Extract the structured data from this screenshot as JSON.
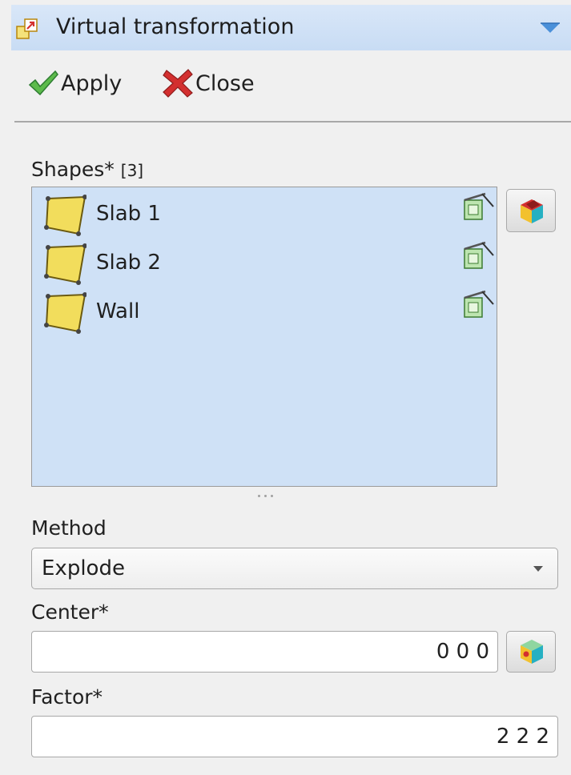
{
  "panel": {
    "title": "Virtual transformation"
  },
  "actions": {
    "apply_label": "Apply",
    "close_label": "Close"
  },
  "shapes": {
    "label": "Shapes*",
    "count": "[3]",
    "items": [
      {
        "label": "Slab 1"
      },
      {
        "label": "Slab 2"
      },
      {
        "label": "Wall"
      }
    ]
  },
  "method": {
    "label": "Method",
    "selected": "Explode"
  },
  "center": {
    "label": "Center*",
    "value": "0 0 0"
  },
  "factor": {
    "label": "Factor*",
    "value": "2 2 2"
  },
  "colors": {
    "title_bar": "#cfe0f6",
    "list_background": "#cfe1f6",
    "panel_background": "#f0f0f0",
    "apply_check": "#4caf50",
    "close_x": "#d32f2f",
    "shape_fill": "#f2dd5c"
  },
  "icons": {
    "title": "virtual-transformation-icon",
    "collapse": "chevron-down-icon",
    "apply": "check-icon",
    "close": "close-x-icon",
    "shape": "face-shape-icon",
    "remove": "delete-bin-icon",
    "select_shapes": "cube-select-icon",
    "pick_center": "cube-point-icon"
  }
}
